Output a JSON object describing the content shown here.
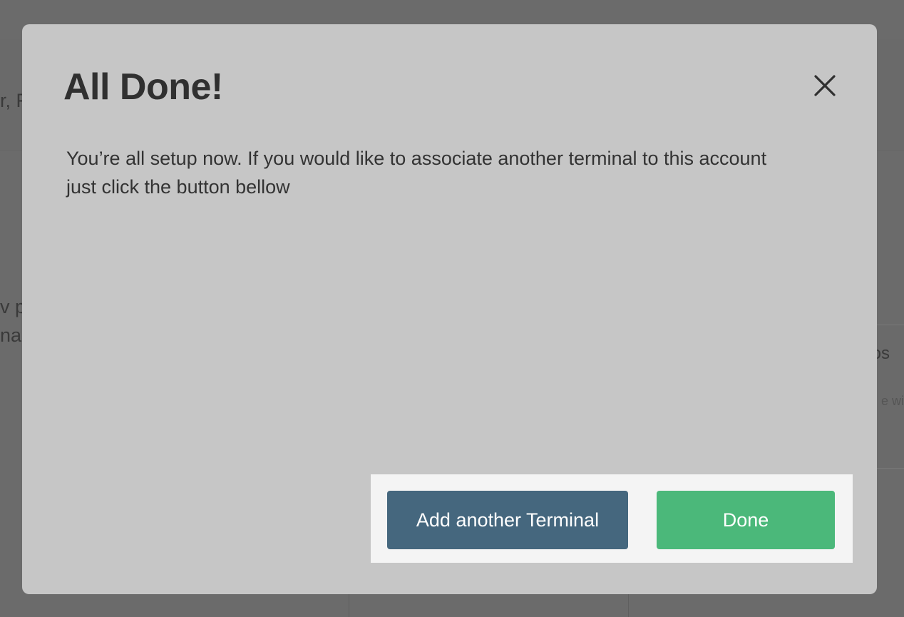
{
  "background": {
    "fragment_1": "r, F",
    "fragment_2": "v p",
    "fragment_3": "na",
    "fragment_4": "os",
    "fragment_5": "e wi"
  },
  "modal": {
    "title": "All Done!",
    "close_icon": "close-icon",
    "message": "You’re all setup now. If you would like to associate another terminal to this account just click the button bellow",
    "buttons": {
      "add_terminal_label": "Add another Terminal",
      "done_label": "Done"
    }
  },
  "colors": {
    "overlay": "#6b6b6b",
    "modal_bg": "#c6c6c6",
    "button_panel_bg": "#f4f4f4",
    "add_terminal_button": "#45677e",
    "done_button": "#4bb87a"
  }
}
